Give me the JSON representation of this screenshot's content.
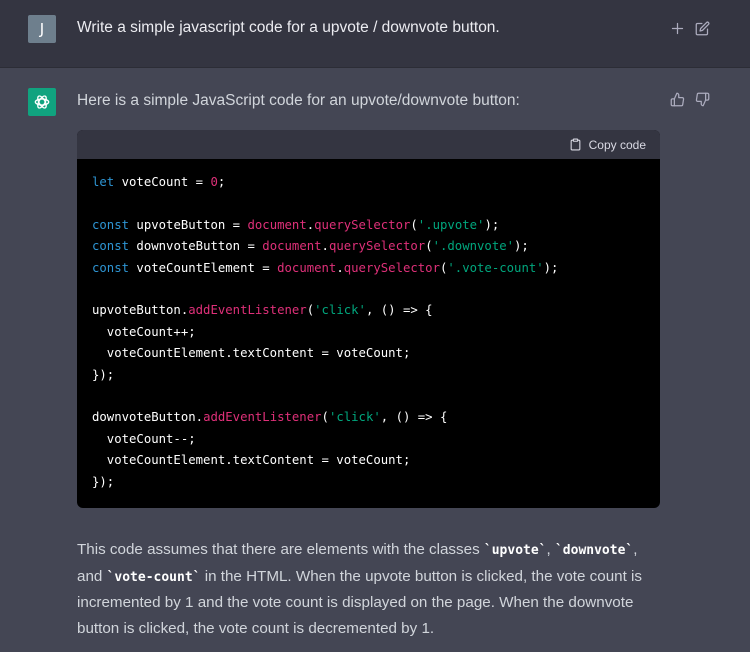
{
  "user_message": {
    "avatar_letter": "J",
    "text": "Write a simple javascript code for a upvote / downvote button."
  },
  "assistant_message": {
    "intro": "Here is a simple JavaScript code for an upvote/downvote button:",
    "copy_label": "Copy code",
    "code": {
      "l1": [
        "let",
        " voteCount = ",
        "0",
        ";"
      ],
      "l2": [
        "const",
        " upvoteButton = ",
        "document",
        ".",
        "querySelector",
        "(",
        "'.upvote'",
        ");"
      ],
      "l3": [
        "const",
        " downvoteButton = ",
        "document",
        ".",
        "querySelector",
        "(",
        "'.downvote'",
        ");"
      ],
      "l4": [
        "const",
        " voteCountElement = ",
        "document",
        ".",
        "querySelector",
        "(",
        "'.vote-count'",
        ");"
      ],
      "l5": [
        "upvoteButton.",
        "addEventListener",
        "(",
        "'click'",
        ", () => {"
      ],
      "l6": "  voteCount++;",
      "l7": "  voteCountElement.textContent = voteCount;",
      "l8": "});",
      "l9": [
        "downvoteButton.",
        "addEventListener",
        "(",
        "'click'",
        ", () => {"
      ],
      "l10": "  voteCount--;",
      "l11": "  voteCountElement.textContent = voteCount;",
      "l12": "});"
    },
    "explanation": {
      "p1": "This code assumes that there are elements with the classes ",
      "c1": "`upvote`",
      "p2": ", ",
      "c2": "`downvote`",
      "p3": ", and ",
      "c3": "`vote-count`",
      "p4": " in the HTML. When the upvote button is clicked, the vote count is incremented by 1 and the vote count is displayed on the page. When the downvote button is clicked, the vote count is decremented by 1."
    }
  },
  "icons": {
    "user_actions": [
      "plus-icon",
      "edit-icon"
    ],
    "assistant_actions": [
      "thumbs-up-icon",
      "thumbs-down-icon"
    ],
    "avatar_bot": "openai-logo-icon",
    "copy": "clipboard-icon"
  },
  "colors": {
    "user_bg": "#343541",
    "assistant_bg": "#444654",
    "bot_avatar": "#10a37f",
    "user_avatar": "#6e7f8d",
    "code_keyword": "#2e95d3",
    "code_function": "#df3079",
    "code_string": "#00a67d"
  }
}
